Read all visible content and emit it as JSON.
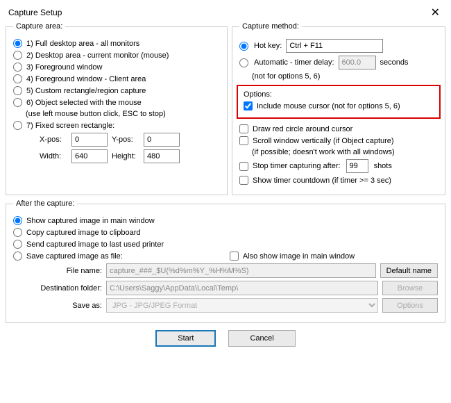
{
  "window": {
    "title": "Capture Setup",
    "close": "✕"
  },
  "captureArea": {
    "legend": "Capture area:",
    "opt1": "1) Full desktop area - all monitors",
    "opt2": "2) Desktop area - current monitor (mouse)",
    "opt3": "3) Foreground window",
    "opt4": "4) Foreground window - Client area",
    "opt5": "5) Custom rectangle/region capture",
    "opt6": "6) Object selected with the mouse",
    "opt6note": "(use left mouse button click, ESC to stop)",
    "opt7": "7) Fixed screen rectangle:",
    "xposLabel": "X-pos:",
    "xpos": "0",
    "yposLabel": "Y-pos:",
    "ypos": "0",
    "widthLabel": "Width:",
    "width": "640",
    "heightLabel": "Height:",
    "height": "480"
  },
  "captureMethod": {
    "legend": "Capture method:",
    "hotkeyLabel": "Hot key:",
    "hotkey": "Ctrl + F11",
    "autoLabel": "Automatic - timer delay:",
    "delay": "600.0",
    "seconds": "seconds",
    "autoNote": "(not for options 5, 6)"
  },
  "options": {
    "title": "Options:",
    "includeCursor": "Include mouse cursor (not for options 5, 6)",
    "drawCircle": "Draw red circle around cursor",
    "scrollWindow": "Scroll window vertically (if Object capture)",
    "scrollNote": "(if possible; doesn't work with all windows)",
    "stopAfter": "Stop timer capturing after:",
    "shots": "99",
    "shotsLabel": "shots",
    "showCountdown": "Show timer countdown (if timer >= 3 sec)"
  },
  "afterCapture": {
    "legend": "After the capture:",
    "showMain": "Show captured image in main window",
    "copyClip": "Copy captured image to clipboard",
    "sendPrinter": "Send captured image to last used printer",
    "saveFile": "Save captured image as file:",
    "alsoShow": "Also show image in main window",
    "fileNameLabel": "File name:",
    "fileName": "capture_###_$U(%d%m%Y_%H%M%S)",
    "defaultName": "Default name",
    "destLabel": "Destination folder:",
    "dest": "C:\\Users\\Saggy\\AppData\\Local\\Temp\\",
    "browse": "Browse",
    "saveAsLabel": "Save as:",
    "saveAs": "JPG - JPG/JPEG Format",
    "optionsBtn": "Options"
  },
  "buttons": {
    "start": "Start",
    "cancel": "Cancel"
  }
}
